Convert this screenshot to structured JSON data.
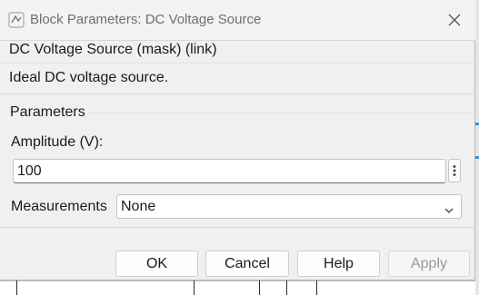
{
  "window": {
    "title": "Block Parameters: DC Voltage Source",
    "icon": "simulink-icon",
    "close_icon": "close-icon"
  },
  "mask": {
    "title": "DC Voltage Source (mask) (link)",
    "description": "Ideal DC voltage source."
  },
  "parameters": {
    "group_label": "Parameters",
    "amplitude": {
      "label": "Amplitude (V):",
      "value": "100"
    },
    "measurements": {
      "label": "Measurements",
      "selected": "None"
    }
  },
  "buttons": {
    "ok": "OK",
    "cancel": "Cancel",
    "help": "Help",
    "apply": "Apply"
  },
  "colors": {
    "dialog_bg": "#f0f0f0",
    "accent": "#3b8ed6"
  }
}
